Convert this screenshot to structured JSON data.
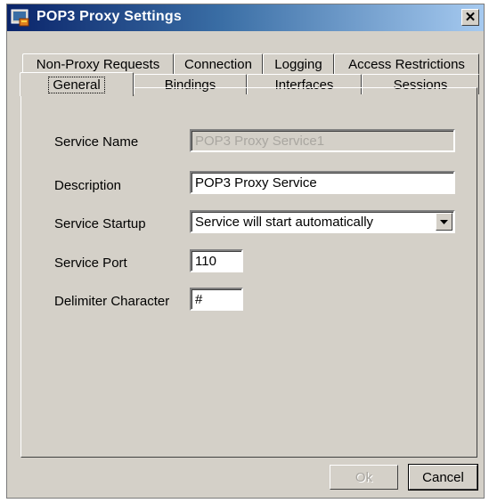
{
  "window": {
    "title": "POP3 Proxy Settings",
    "close_glyph": "✕"
  },
  "tabs": {
    "row1": [
      "Non-Proxy Requests",
      "Connection",
      "Logging",
      "Access Restrictions"
    ],
    "row2": [
      "General",
      "Bindings",
      "Interfaces",
      "Sessions"
    ],
    "active": "General"
  },
  "form": {
    "service_name_label": "Service Name",
    "service_name_value": "POP3 Proxy Service1",
    "description_label": "Description",
    "description_value": "POP3 Proxy Service",
    "startup_label": "Service Startup",
    "startup_value": "Service will start automatically",
    "port_label": "Service Port",
    "port_value": "110",
    "delimiter_label": "Delimiter Character",
    "delimiter_value": "#"
  },
  "buttons": {
    "ok": "Ok",
    "cancel": "Cancel"
  },
  "colors": {
    "titlebar_start": "#0a246a",
    "titlebar_end": "#a6caf0",
    "face": "#d4d0c8"
  }
}
